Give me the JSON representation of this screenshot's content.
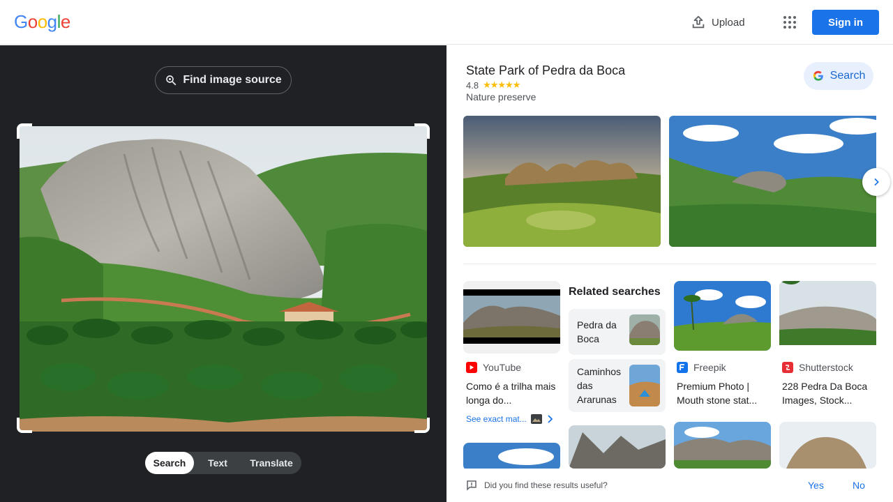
{
  "header": {
    "logo_letters": [
      "G",
      "o",
      "o",
      "g",
      "l",
      "e"
    ],
    "upload_label": "Upload",
    "signin_label": "Sign in"
  },
  "lens": {
    "find_source_label": "Find image source",
    "modes": [
      {
        "label": "Search",
        "active": true
      },
      {
        "label": "Text",
        "active": false
      },
      {
        "label": "Translate",
        "active": false
      }
    ]
  },
  "knowledge_panel": {
    "title": "State Park of Pedra da Boca",
    "rating": "4.8",
    "stars": "★★★★★",
    "subtitle": "Nature preserve",
    "search_label": "Search"
  },
  "results": {
    "related_heading": "Related searches",
    "related": [
      {
        "label": "Pedra da Boca"
      },
      {
        "label": "Caminhos das Ararunas"
      }
    ],
    "cards": [
      {
        "source": "YouTube",
        "title": "Como é a trilha mais longa do...",
        "icon_color": "#ff0000"
      },
      {
        "source": "Freepik",
        "title": "Premium Photo | Mouth stone stat...",
        "icon_color": "#1273eb"
      },
      {
        "source": "Shutterstock",
        "title": "228 Pedra Da Boca Images, Stock...",
        "icon_color": "#e72e35"
      }
    ],
    "see_exact_label": "See exact mat..."
  },
  "feedback": {
    "question": "Did you find these results useful?",
    "yes_label": "Yes",
    "no_label": "No"
  },
  "colors": {
    "accent": "#1a73e8",
    "dark_bg": "#202124",
    "star": "#fbbc04"
  }
}
